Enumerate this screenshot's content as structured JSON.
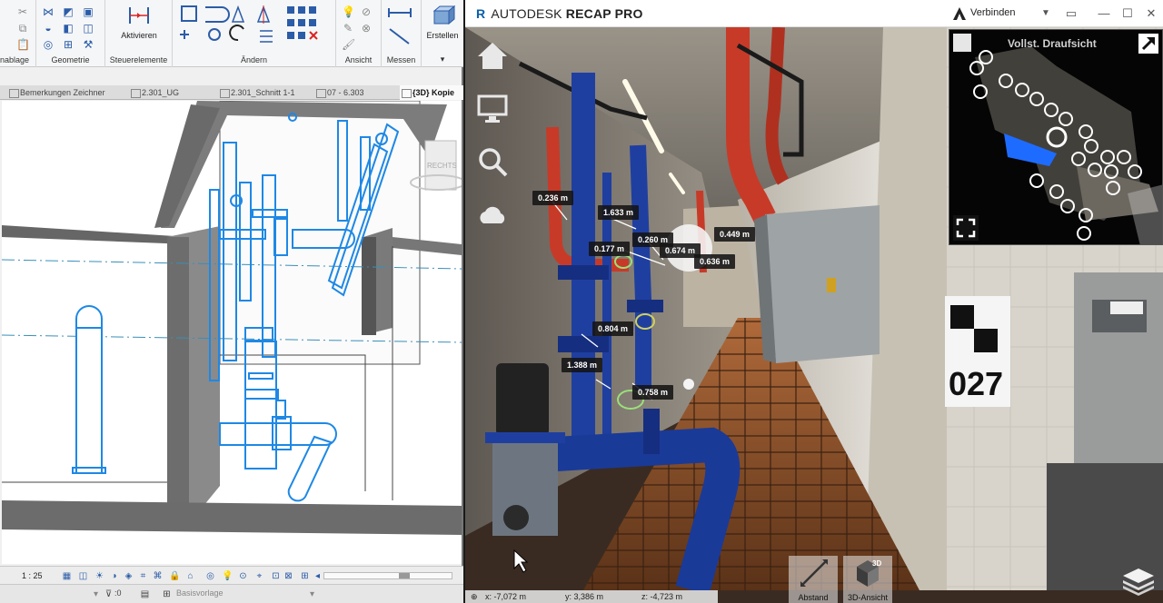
{
  "revit": {
    "ribbon": {
      "groups": [
        {
          "label": "nablage"
        },
        {
          "label": "Geometrie"
        },
        {
          "label": "Steuerelemente",
          "button": "Aktivieren"
        },
        {
          "label": "Ändern"
        },
        {
          "label": "Ansicht"
        },
        {
          "label": "Messen"
        },
        {
          "label": "",
          "button": "Erstellen"
        }
      ]
    },
    "tabs": [
      {
        "label": "Bemerkungen Zeichner"
      },
      {
        "label": "2.301_UG"
      },
      {
        "label": "2.301_Schnitt 1-1"
      },
      {
        "label": "07 - 6.303"
      },
      {
        "label": "{3D} Kopie"
      }
    ],
    "viewcube_label": "RECHTS",
    "status": {
      "scale": "1 : 25",
      "selection_count": ":0",
      "template": "Basisvorlage"
    }
  },
  "recap": {
    "brand": {
      "prefix": "AUTODESK",
      "product": "RECAP PRO"
    },
    "connect_label": "Verbinden",
    "minimap_label": "Vollst. Draufsicht",
    "measurements": [
      {
        "value": "0.236 m"
      },
      {
        "value": "1.633 m"
      },
      {
        "value": "0.177 m"
      },
      {
        "value": "0.260 m"
      },
      {
        "value": "0.674 m"
      },
      {
        "value": "0.449 m"
      },
      {
        "value": "0.636 m"
      },
      {
        "value": "0.804 m"
      },
      {
        "value": "1.388 m"
      },
      {
        "value": "0.758 m"
      }
    ],
    "bottom_buttons": {
      "distance": "Abstand",
      "view3d": "3D-Ansicht"
    },
    "coords": {
      "x": "x:   -7,072  m",
      "y": "y:  3,386  m",
      "z": "z:   -4,723  m"
    },
    "sign_number": "027",
    "colors": {
      "brand_blue": "#0b5fa8",
      "pipe_blue": "#1f3fa0",
      "pipe_red": "#c83a28",
      "cad_blue": "#1e88e5"
    }
  }
}
